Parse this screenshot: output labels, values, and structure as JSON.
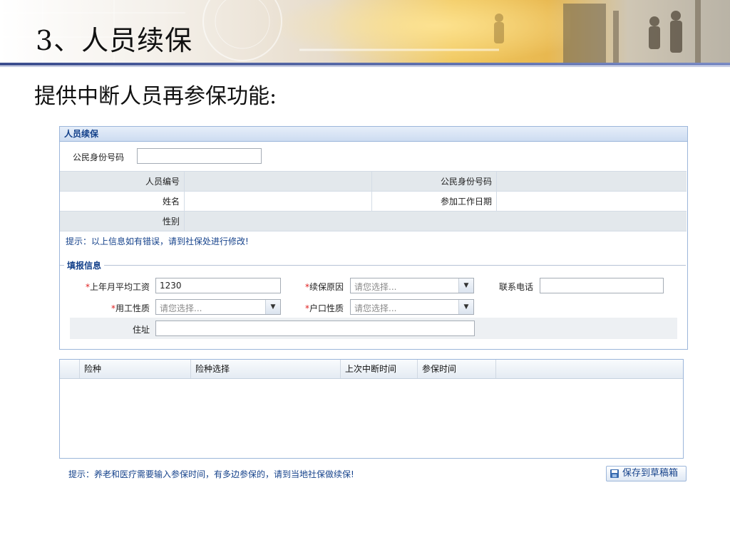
{
  "slide": {
    "title": "3、人员续保",
    "subtitle": "提供中断人员再参保功能:"
  },
  "panel": {
    "title": "人员续保",
    "search_label": "公民身份号码",
    "search_value": "",
    "info_rows": [
      {
        "l1": "人员编号",
        "v1": "",
        "l2": "公民身份号码",
        "v2": ""
      },
      {
        "l1": "姓名",
        "v1": "",
        "l2": "参加工作日期",
        "v2": ""
      },
      {
        "l1": "性别",
        "v1": ""
      }
    ],
    "tip": "提示：以上信息如有错误，请到社保处进行修改!",
    "fieldset_legend": "填报信息",
    "fields": {
      "avg_wage_label": "上年月平均工资",
      "avg_wage_value": "1230",
      "reason_label": "续保原因",
      "reason_placeholder": "请您选择...",
      "phone_label": "联系电话",
      "phone_value": "",
      "employment_label": "用工性质",
      "employment_placeholder": "请您选择...",
      "household_label": "户口性质",
      "household_placeholder": "请您选择...",
      "address_label": "住址",
      "address_value": ""
    },
    "required_mark": "*"
  },
  "grid": {
    "columns": [
      "险种",
      "险种选择",
      "上次中断时间",
      "参保时间"
    ],
    "rows": []
  },
  "footer": {
    "tip": "提示：养老和医疗需要输入参保时间，有多边参保的，请到当地社保做续保!",
    "save_label": "保存到草稿箱"
  },
  "icons": {
    "dropdown": "chevron-down-icon",
    "save": "floppy-disk-icon"
  }
}
